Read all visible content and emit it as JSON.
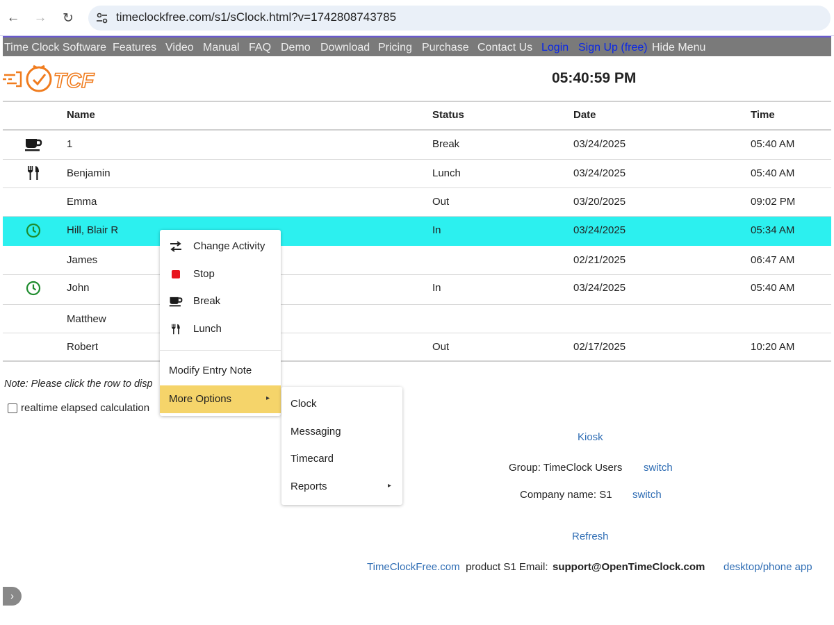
{
  "browser": {
    "url": "timeclockfree.com/s1/sClock.html?v=1742808743785"
  },
  "menu": {
    "items": [
      {
        "label": "Time Clock Software"
      },
      {
        "label": "Features"
      },
      {
        "label": "Video"
      },
      {
        "label": "Manual"
      },
      {
        "label": "FAQ"
      },
      {
        "label": "Demo"
      },
      {
        "label": "Download"
      },
      {
        "label": "Pricing"
      },
      {
        "label": "Purchase"
      },
      {
        "label": "Contact Us"
      },
      {
        "label": "Login"
      },
      {
        "label": "Sign Up (free)"
      },
      {
        "label": "Hide Menu"
      }
    ]
  },
  "header": {
    "logo_text": "TCF",
    "clock_time": "05:40:59 PM"
  },
  "table": {
    "headers": {
      "name": "Name",
      "status": "Status",
      "date": "Date",
      "time": "Time"
    },
    "rows": [
      {
        "icon": "coffee-icon",
        "name": "1",
        "status": "Break",
        "date": "03/24/2025",
        "time": "05:40 AM"
      },
      {
        "icon": "utensils-icon",
        "name": "Benjamin",
        "status": "Lunch",
        "date": "03/24/2025",
        "time": "05:40 AM"
      },
      {
        "icon": "",
        "name": "Emma",
        "status": "Out",
        "date": "03/20/2025",
        "time": "09:02 PM"
      },
      {
        "icon": "clock-icon",
        "name": "Hill, Blair R",
        "status": "In",
        "date": "03/24/2025",
        "time": "05:34 AM",
        "selected": true
      },
      {
        "icon": "",
        "name": "James",
        "status": "",
        "date": "02/21/2025",
        "time": "06:47 AM"
      },
      {
        "icon": "clock-icon",
        "name": "John",
        "status": "In",
        "date": "03/24/2025",
        "time": "05:40 AM"
      },
      {
        "icon": "",
        "name": "Matthew",
        "status": "",
        "date": "",
        "time": ""
      },
      {
        "icon": "",
        "name": "Robert",
        "status": "Out",
        "date": "02/17/2025",
        "time": "10:20 AM"
      }
    ]
  },
  "note": "Note: Please click the row to disp",
  "realtime_label": "realtime elapsed calculation",
  "footer": {
    "kiosk": "Kiosk",
    "group_label": "Group: TimeClock Users",
    "group_switch": "switch",
    "company_label": "Company name: S1",
    "company_switch": "switch",
    "refresh": "Refresh",
    "site_link": "TimeClockFree.com",
    "product_text": " product S1 Email: ",
    "email": "support@OpenTimeClock.com",
    "app_link": "desktop/phone app"
  },
  "context_menu": {
    "items": [
      {
        "label": "Change Activity",
        "icon": "swap-arrows-icon"
      },
      {
        "label": "Stop",
        "icon": "stop-icon"
      },
      {
        "label": "Break",
        "icon": "coffee-icon"
      },
      {
        "label": "Lunch",
        "icon": "utensils-icon"
      },
      {
        "label": "Modify Entry Note"
      },
      {
        "label": "More Options",
        "highlighted": true
      }
    ]
  },
  "submenu": {
    "items": [
      {
        "label": "Clock"
      },
      {
        "label": "Messaging"
      },
      {
        "label": "Timecard"
      },
      {
        "label": "Reports"
      }
    ]
  },
  "colors": {
    "selected_row": "#2cf0ef",
    "menu_bar": "#7a7a7a",
    "menu_highlight": "#f5d46a",
    "link": "#2f6db4",
    "logo_orange": "#f07c1e",
    "clock_green": "#1e8c2e",
    "stop_red": "#e8141e"
  }
}
